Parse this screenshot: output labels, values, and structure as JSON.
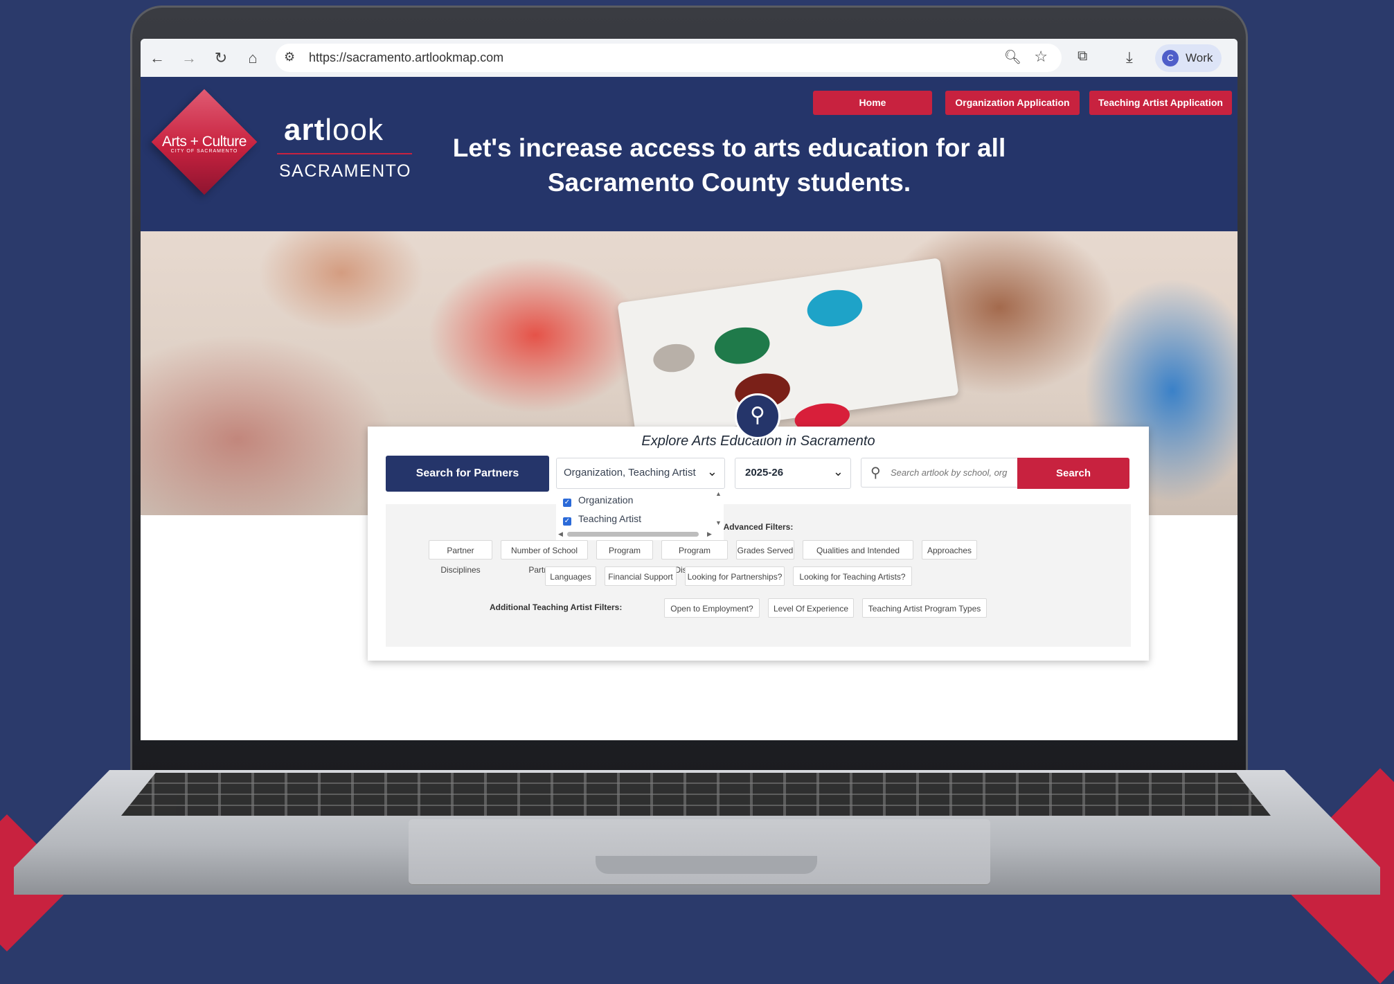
{
  "browser": {
    "url": "https://sacramento.artlookmap.com",
    "profile_initial": "C",
    "profile_name": "Work"
  },
  "brand": {
    "logo_text": "Arts + Culture",
    "logo_subtext": "CITY OF SACRAMENTO",
    "name_bold": "art",
    "name_light": "look",
    "city": "SACRAMENTO"
  },
  "nav": {
    "items": [
      {
        "label": "Home"
      },
      {
        "label": "Organization Application"
      },
      {
        "label": "Teaching Artist Application"
      }
    ]
  },
  "header": {
    "headline_line1": "Let's increase access to arts education for all",
    "headline_line2": "Sacramento County students."
  },
  "search": {
    "title": "Explore Arts Education in Sacramento",
    "partners_button": "Search for Partners",
    "type_select": "Organization, Teaching Artist",
    "type_options": [
      {
        "label": "Organization",
        "checked": true
      },
      {
        "label": "Teaching Artist",
        "checked": true
      }
    ],
    "year_select": "2025-26",
    "placeholder": "Search artlook by school, org",
    "search_button": "Search"
  },
  "filters": {
    "advanced_label": "Advanced Filters:",
    "row1": [
      "Partner Disciplines",
      "Number of School Partners",
      "Program Types",
      "Program Disciplines",
      "Grades Served",
      "Qualities and Intended Outcomes",
      "Approaches"
    ],
    "row2": [
      "Languages",
      "Financial Support",
      "Looking for Partnerships?",
      "Looking for Teaching Artists?"
    ],
    "teaching_artist_label": "Additional Teaching Artist Filters:",
    "row3": [
      "Open to Employment?",
      "Level Of Experience",
      "Teaching Artist Program Types"
    ]
  },
  "colors": {
    "navy": "#25356a",
    "accent_red": "#c8223f",
    "background": "#2b3a6b"
  }
}
